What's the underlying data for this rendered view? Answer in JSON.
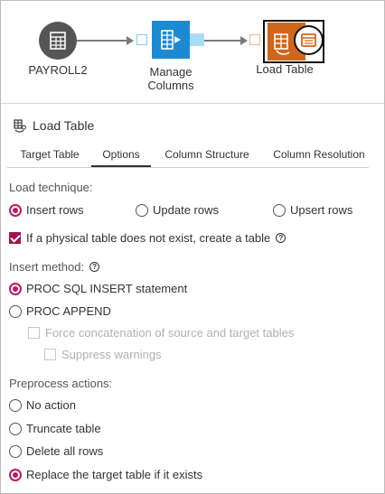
{
  "flow": {
    "nodes": [
      {
        "label": "PAYROLL2"
      },
      {
        "label": "Manage\nColumns"
      },
      {
        "label": "Load Table"
      }
    ]
  },
  "header": {
    "title": "Load Table",
    "icon": "load-table-icon"
  },
  "tabs": [
    {
      "label": "Target Table",
      "active": false
    },
    {
      "label": "Options",
      "active": true
    },
    {
      "label": "Column Structure",
      "active": false
    },
    {
      "label": "Column Resolution",
      "active": false
    }
  ],
  "load_technique": {
    "label": "Load technique:",
    "options": [
      "Insert rows",
      "Update rows",
      "Upsert rows"
    ],
    "selected": "Insert rows"
  },
  "create_table_checkbox": {
    "label": "If a physical table does not exist, create a table",
    "checked": true
  },
  "insert_method": {
    "label": "Insert method:",
    "options": [
      "PROC SQL INSERT statement",
      "PROC APPEND"
    ],
    "selected": "PROC SQL INSERT statement",
    "force_concat_label": "Force concatenation of source and target tables",
    "suppress_warnings_label": "Suppress warnings"
  },
  "preprocess": {
    "label": "Preprocess actions:",
    "options": [
      "No action",
      "Truncate table",
      "Delete all rows",
      "Replace the target table if it exists"
    ],
    "selected": "Replace the target table if it exists"
  },
  "colors": {
    "accent": "#c0185c",
    "manage_node": "#1b8ad1",
    "load_node": "#d0661b",
    "table_node": "#555555"
  }
}
